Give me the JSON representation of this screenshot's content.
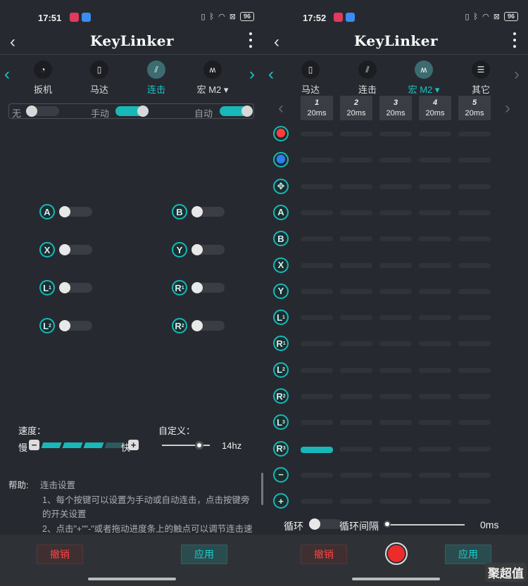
{
  "left": {
    "status": {
      "time": "17:51",
      "battery": "96"
    },
    "title": "KeyLinker",
    "tabs": [
      {
        "label": "扳机",
        "icon": "trigger-icon"
      },
      {
        "label": "马达",
        "icon": "vibration-icon"
      },
      {
        "label": "连击",
        "icon": "turbo-icon"
      },
      {
        "label": "宏 M2 ▾",
        "icon": "macro-icon"
      }
    ],
    "modes": {
      "none": "无",
      "manual": "手动",
      "auto": "自动"
    },
    "buttons": [
      {
        "key": "A",
        "sub": "",
        "enabled": false
      },
      {
        "key": "B",
        "sub": "",
        "enabled": false
      },
      {
        "key": "X",
        "sub": "",
        "enabled": false
      },
      {
        "key": "Y",
        "sub": "",
        "enabled": false
      },
      {
        "key": "L",
        "sub": "1",
        "enabled": false
      },
      {
        "key": "R",
        "sub": "1",
        "enabled": false
      },
      {
        "key": "L",
        "sub": "2",
        "enabled": false
      },
      {
        "key": "R",
        "sub": "2",
        "enabled": false
      }
    ],
    "speed": {
      "label": "速度：",
      "slow": "慢",
      "fast": "快",
      "minus": "−",
      "plus": "+",
      "level": 0.75
    },
    "custom": {
      "label": "自定义：",
      "value": "14hz",
      "fraction": 0.78
    },
    "help": {
      "key": "帮助:",
      "title": "连击设置",
      "line1": "1、每个按键可以设置为手动或自动连击，点击按键旁",
      "line1b": "的开关设置",
      "line2": "2、点击\"+\"\"-\"或者拖动进度条上的触点可以调节连击速"
    },
    "bottom": {
      "cancel": "撤销",
      "apply": "应用"
    }
  },
  "right": {
    "status": {
      "time": "17:52",
      "battery": "96"
    },
    "title": "KeyLinker",
    "tabs": [
      {
        "label": "马达",
        "icon": "vibration-icon"
      },
      {
        "label": "连击",
        "icon": "turbo-icon"
      },
      {
        "label": "宏 M2 ▾",
        "icon": "macro-icon"
      },
      {
        "label": "其它",
        "icon": "list-icon"
      }
    ],
    "steps": [
      {
        "num": "1",
        "time": "20ms"
      },
      {
        "num": "2",
        "time": "20ms"
      },
      {
        "num": "3",
        "time": "20ms"
      },
      {
        "num": "4",
        "time": "20ms"
      },
      {
        "num": "5",
        "time": "20ms"
      }
    ],
    "rows": [
      {
        "key": "",
        "sub": "",
        "kind": "red"
      },
      {
        "key": "",
        "sub": "",
        "kind": "blue"
      },
      {
        "key": "✥",
        "sub": "",
        "kind": "dpad"
      },
      {
        "key": "A",
        "sub": "",
        "kind": "btn"
      },
      {
        "key": "B",
        "sub": "",
        "kind": "btn"
      },
      {
        "key": "X",
        "sub": "",
        "kind": "btn"
      },
      {
        "key": "Y",
        "sub": "",
        "kind": "btn"
      },
      {
        "key": "L",
        "sub": "1",
        "kind": "btn"
      },
      {
        "key": "R",
        "sub": "1",
        "kind": "btn"
      },
      {
        "key": "L",
        "sub": "2",
        "kind": "btn"
      },
      {
        "key": "R",
        "sub": "2",
        "kind": "btn"
      },
      {
        "key": "L",
        "sub": "3",
        "kind": "btn"
      },
      {
        "key": "R",
        "sub": "3",
        "kind": "btn"
      },
      {
        "key": "−",
        "sub": "",
        "kind": "btn"
      },
      {
        "key": "+",
        "sub": "",
        "kind": "btn"
      }
    ],
    "active": {
      "row": 12,
      "col": 0
    },
    "loop": {
      "label": "循环",
      "interval_label": "循环间隔",
      "value": "0ms",
      "fraction": 0
    },
    "bottom": {
      "cancel": "撤销",
      "apply": "应用"
    },
    "corner": "聚超值"
  }
}
